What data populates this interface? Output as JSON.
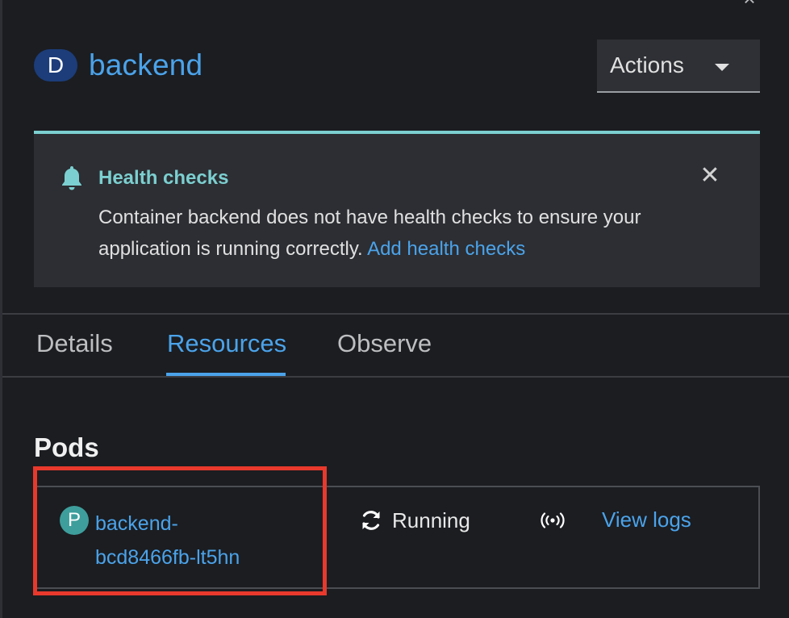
{
  "panel": {
    "close_glyph": "×",
    "badge_letter": "D",
    "title": "backend",
    "actions_label": "Actions"
  },
  "alert": {
    "title": "Health checks",
    "body_text": "Container backend does not have health checks to ensure your application is running correctly. ",
    "link_text": "Add health checks",
    "close_glyph": "✕"
  },
  "tabs": [
    {
      "label": "Details",
      "active": false
    },
    {
      "label": "Resources",
      "active": true
    },
    {
      "label": "Observe",
      "active": false
    }
  ],
  "pods": {
    "section_title": "Pods",
    "items": [
      {
        "badge_letter": "P",
        "name_line1": "backend-",
        "name_line2": "bcd8466fb-lt5hn",
        "status": "Running",
        "logs_label": "View logs"
      }
    ]
  },
  "colors": {
    "accent": "#4ba3ea",
    "alert_accent": "#7ccfd0",
    "highlight": "#e8392c",
    "pod_badge": "#3e9e9c",
    "d_badge": "#1c3d7a"
  },
  "icons": [
    "close-icon",
    "bell-icon",
    "caret-down-icon",
    "sync-icon",
    "signal-icon"
  ]
}
